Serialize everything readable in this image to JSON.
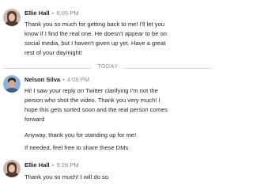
{
  "messages": [
    {
      "sender": "Ellie Hall",
      "time": "6:05 PM",
      "avatar_icon": "person-avatar-icon",
      "lines": [
        "Thank you so much for getting back to me! I'll let you",
        "know if I find the real one. He doesn't appear to be on",
        "social media, but I haven't given up yet. Have a great",
        "rest of your day/night!"
      ]
    },
    {
      "sender": "Nelson Silva",
      "time": "4:06 PM",
      "avatar_icon": "person-avatar-icon",
      "paragraphs": [
        [
          "Hi! I saw your reply on Twitter clarifying I'm not the",
          "person who shot the video. Thank you very much! I",
          "hope this gets sorted soon and the real person comes",
          "forward"
        ],
        [
          "Anyway, thank you for standing up for me!"
        ],
        [
          "If needed, feel free to share these DMs"
        ]
      ]
    },
    {
      "sender": "Ellie Hall",
      "time": "5:28 PM",
      "avatar_icon": "person-avatar-icon",
      "lines": [
        "Thank you so much! I will do so."
      ]
    }
  ],
  "divider": {
    "label": "TODAY"
  },
  "colors": {
    "meta_gray": "#8a8a8a",
    "divider_line": "#d9d9d9"
  }
}
